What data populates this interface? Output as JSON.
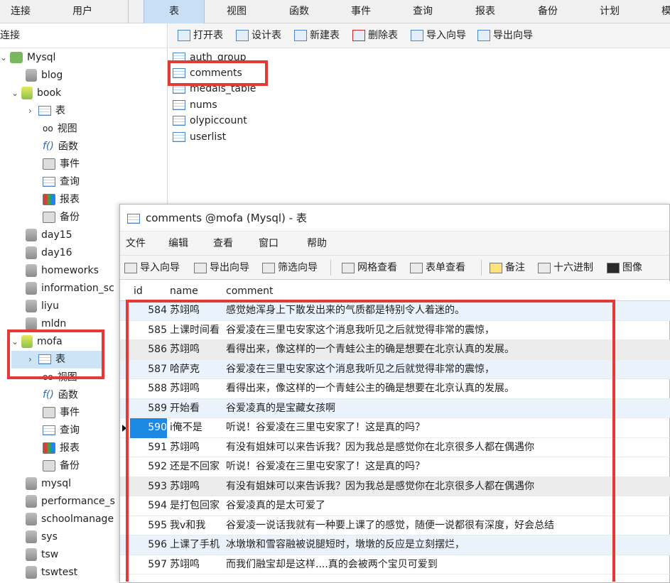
{
  "topbar": {
    "left_items": [
      "连接",
      "用户"
    ],
    "tabs": [
      "表",
      "视图",
      "函数",
      "事件",
      "查询",
      "报表",
      "备份",
      "计划",
      "模"
    ]
  },
  "left_panel": {
    "header": "连接",
    "items": [
      {
        "label": "Mysql",
        "type": "connection"
      },
      {
        "label": "blog",
        "type": "db"
      },
      {
        "label": "book",
        "type": "db"
      },
      {
        "label": "表",
        "type": "table"
      },
      {
        "label": "视图",
        "type": "view"
      },
      {
        "label": "函数",
        "type": "function"
      },
      {
        "label": "事件",
        "type": "event"
      },
      {
        "label": "查询",
        "type": "query"
      },
      {
        "label": "报表",
        "type": "report"
      },
      {
        "label": "备份",
        "type": "backup"
      },
      {
        "label": "day15",
        "type": "db"
      },
      {
        "label": "day16",
        "type": "db"
      },
      {
        "label": "homeworks",
        "type": "db"
      },
      {
        "label": "information_sc",
        "type": "db"
      },
      {
        "label": "liyu",
        "type": "db"
      },
      {
        "label": "mldn",
        "type": "db"
      },
      {
        "label": "mofa",
        "type": "db"
      },
      {
        "label": "表",
        "type": "table"
      },
      {
        "label": "视图",
        "type": "view"
      },
      {
        "label": "函数",
        "type": "function"
      },
      {
        "label": "事件",
        "type": "event"
      },
      {
        "label": "查询",
        "type": "query"
      },
      {
        "label": "报表",
        "type": "report"
      },
      {
        "label": "备份",
        "type": "backup"
      },
      {
        "label": "mysql",
        "type": "db"
      },
      {
        "label": "performance_s",
        "type": "db"
      },
      {
        "label": "schoolmanage",
        "type": "db"
      },
      {
        "label": "sys",
        "type": "db"
      },
      {
        "label": "tsw",
        "type": "db"
      },
      {
        "label": "tswtest",
        "type": "db"
      }
    ]
  },
  "right_toolbar": {
    "buttons": [
      "打开表",
      "设计表",
      "新建表",
      "删除表",
      "导入向导",
      "导出向导"
    ]
  },
  "tables": [
    "auth_group",
    "comments",
    "medals_table",
    "nums",
    "olypiccount",
    "userlist"
  ],
  "subwindow": {
    "title": "comments @mofa (Mysql) - 表",
    "menu": [
      "文件",
      "编辑",
      "查看",
      "窗口",
      "帮助"
    ],
    "tools": [
      "导入向导",
      "导出向导",
      "筛选向导",
      "网格查看",
      "表单查看",
      "备注",
      "十六进制",
      "图像"
    ],
    "columns": [
      "id",
      "name",
      "comment"
    ],
    "rows": [
      {
        "id": "584",
        "name": "苏翊鸣",
        "comment": "感觉她浑身上下散发出来的气质都是特别令人着迷的。"
      },
      {
        "id": "585",
        "name": "上课时间看",
        "comment": "谷爱凌在三里屯安家这个消息我听见之后就觉得非常的震惊，"
      },
      {
        "id": "586",
        "name": "苏翊鸣",
        "comment": "看得出来，像这样的一个青蛙公主的确是想要在北京认真的发展。"
      },
      {
        "id": "587",
        "name": "哈萨克",
        "comment": "谷爱凌在三里屯安家这个消息我听见之后就觉得非常的震惊，"
      },
      {
        "id": "588",
        "name": "苏翊鸣",
        "comment": "看得出来，像这样的一个青蛙公主的确是想要在北京认真的发展。"
      },
      {
        "id": "589",
        "name": "开始看",
        "comment": "谷爱凌真的是宝藏女孩啊"
      },
      {
        "id": "590",
        "name": "i俺不是",
        "comment": "听说！谷爱凌在三里屯安家了！这是真的吗？"
      },
      {
        "id": "591",
        "name": "苏翊鸣",
        "comment": "有没有姐妹可以来告诉我？因为我总是感觉你在北京很多人都在偶遇你"
      },
      {
        "id": "592",
        "name": "还是不回家",
        "comment": "听说！谷爱凌在三里屯安家了！这是真的吗？"
      },
      {
        "id": "593",
        "name": "苏翊鸣",
        "comment": "有没有姐妹可以来告诉我？因为我总是感觉你在北京很多人都在偶遇你"
      },
      {
        "id": "594",
        "name": "是打包回家",
        "comment": "谷爱凌真的是太可爱了"
      },
      {
        "id": "595",
        "name": "我v和我",
        "comment": "谷爱凌一说话我就有一种要上课了的感觉，随便一说都很有深度，好会总结"
      },
      {
        "id": "596",
        "name": "上课了手机",
        "comment": "冰墩墩和雪容融被说腿短时，墩墩的反应是立刻摆烂，"
      },
      {
        "id": "597",
        "name": "苏翊鸣",
        "comment": "而我们融宝却是这样....真的会被两个宝贝可爱到"
      }
    ]
  }
}
